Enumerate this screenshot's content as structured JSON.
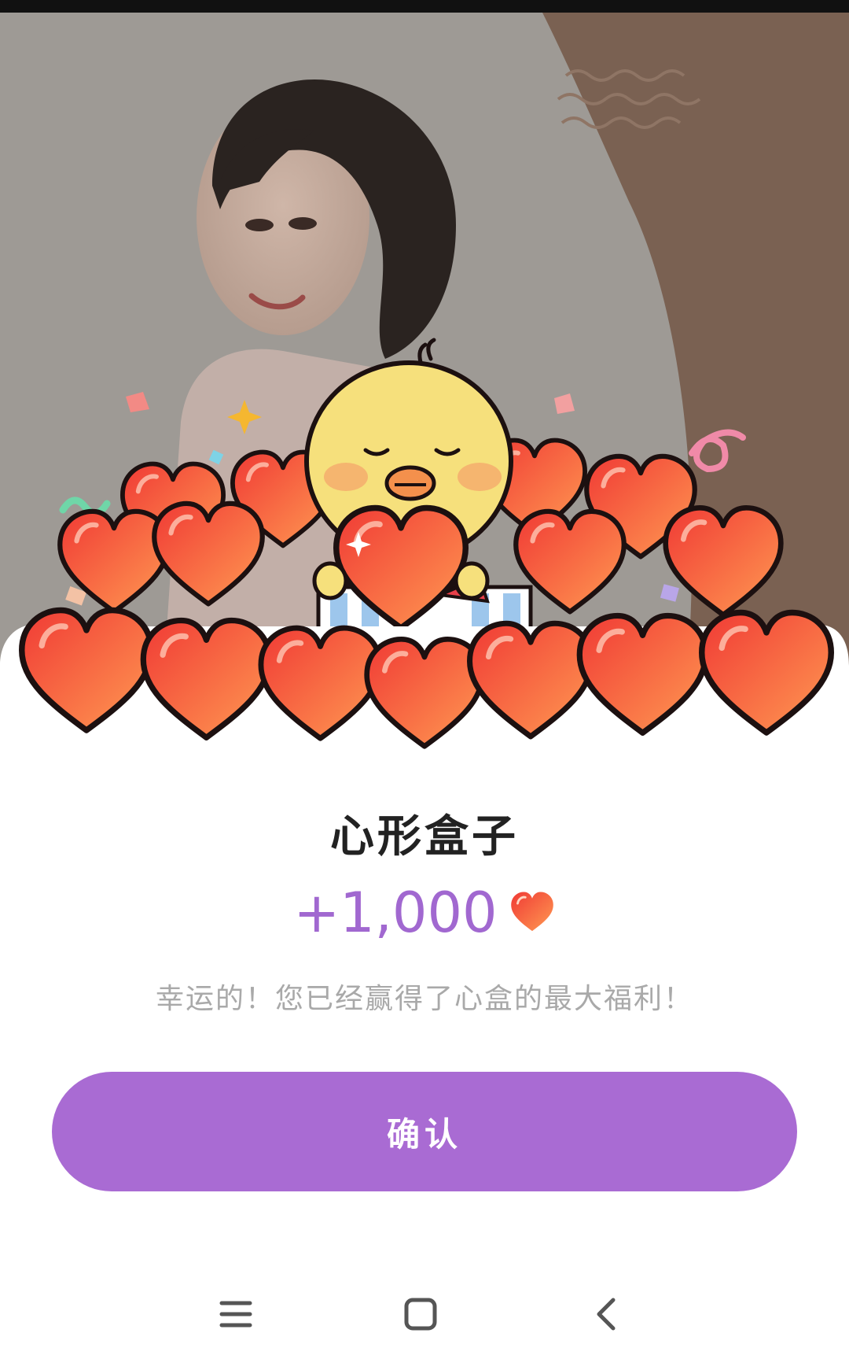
{
  "dialog": {
    "title": "心形盒子",
    "reward_amount": "+1,000",
    "reward_icon": "heart-icon",
    "message": "幸运的！您已经赢得了心盒的最大福利！",
    "confirm_label": "确认"
  },
  "colors": {
    "accent": "#a96bd3",
    "amount": "#a168d0",
    "heart_red": "#f04a3c",
    "heart_orange": "#ff8f4c",
    "message_gray": "#a9a9a9"
  },
  "nav": {
    "icons": [
      "menu-icon",
      "home-icon",
      "back-icon"
    ]
  }
}
